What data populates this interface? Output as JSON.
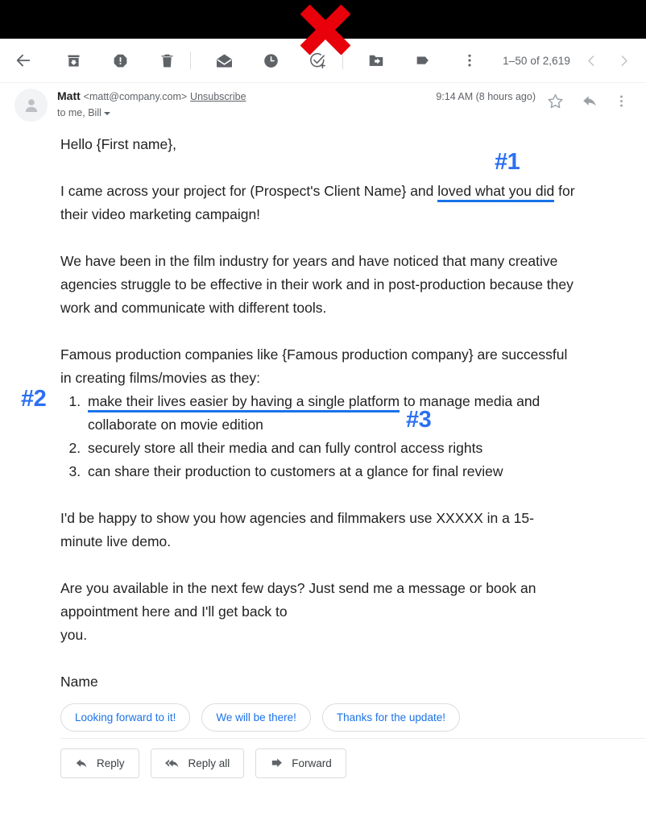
{
  "toolbar": {
    "back_label": "Back",
    "icons": [
      {
        "name": "back-arrow-icon",
        "label": "Back to Inbox"
      },
      {
        "name": "archive-icon",
        "label": "Archive"
      },
      {
        "name": "report-spam-icon",
        "label": "Report spam"
      },
      {
        "name": "delete-icon",
        "label": "Delete"
      },
      {
        "name": "mark-unread-icon",
        "label": "Mark as unread"
      },
      {
        "name": "snooze-clock-icon",
        "label": "Snooze"
      },
      {
        "name": "add-to-tasks-icon",
        "label": "Add to Tasks"
      },
      {
        "name": "move-to-folder-icon",
        "label": "Move to"
      },
      {
        "name": "label-tag-icon",
        "label": "Labels"
      },
      {
        "name": "more-options-icon",
        "label": "More"
      }
    ],
    "pagination": "1–50 of 2,619",
    "prev_label": "Newer",
    "next_label": "Older"
  },
  "message_header": {
    "sender_name": "Matt",
    "sender_email": "<matt@company.com>",
    "unsubscribe_label": "Unsubscribe",
    "recipients": "to me, Bill",
    "timestamp": "9:14 AM (8 hours ago)",
    "star_label": "Star",
    "reply_label": "Reply",
    "more_label": "More"
  },
  "body": {
    "greeting": "Hello {First name},",
    "para_intro_before": "I came across your project for (Prospect's Client Name} and ",
    "para_intro_hl1": "loved what you did",
    "para_intro_after": " for their video marketing campaign!",
    "para_2": "We have been in the film industry for years and have noticed that many creative agencies struggle to be effective in their work and in post-production because they work and communicate with different tools.",
    "para_3": "Famous production companies like {Famous production company} are successful in creating films/movies as they:",
    "list": [
      {
        "highlight": "make their lives easier by having a single platform",
        "rest": " to manage media and collaborate on movie edition"
      },
      {
        "highlight": "",
        "rest": "securely store all their media and can fully control access rights"
      },
      {
        "highlight": "",
        "rest": "can share their production to customers at a glance for final review"
      }
    ],
    "para_4": "I'd be happy to show you how agencies and filmmakers use XXXXX in a 15-minute live demo.",
    "para_5": "Are you available in the next few days? Just send me a message or book an appointment here and I'll get back to",
    "para_5b": "you.",
    "signature": "Name"
  },
  "annotations": [
    {
      "label": "#1",
      "color": "#2b70f2"
    },
    {
      "label": "#2",
      "color": "#2b70f2"
    },
    {
      "label": "#3",
      "color": "#2b70f2"
    }
  ],
  "smart_replies": [
    "Looking forward to it!",
    "We will be there!",
    "Thanks for the update!"
  ],
  "actions": [
    {
      "label": "Reply",
      "icon": "reply-arrow-icon"
    },
    {
      "label": "Reply all",
      "icon": "reply-all-arrow-icon"
    },
    {
      "label": "Forward",
      "icon": "forward-arrow-icon"
    }
  ],
  "colors": {
    "accent_blue": "#1a73e8",
    "annotation_blue": "#2b70f2",
    "overlay_red": "#e8000b",
    "icon_gray": "#5f6368",
    "text_primary": "#202124"
  }
}
